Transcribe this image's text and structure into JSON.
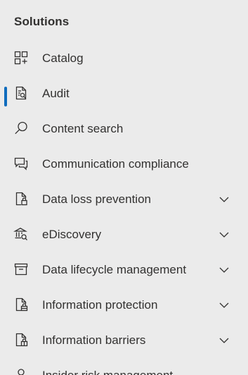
{
  "sidebar": {
    "section_title": "Solutions",
    "items": [
      {
        "label": "Catalog",
        "icon": "catalog-icon",
        "selected": false,
        "expandable": false
      },
      {
        "label": "Audit",
        "icon": "audit-icon",
        "selected": true,
        "expandable": false
      },
      {
        "label": "Content search",
        "icon": "search-icon",
        "selected": false,
        "expandable": false
      },
      {
        "label": "Communication compliance",
        "icon": "chat-icon",
        "selected": false,
        "expandable": false
      },
      {
        "label": "Data loss prevention",
        "icon": "lock-document-icon",
        "selected": false,
        "expandable": true
      },
      {
        "label": "eDiscovery",
        "icon": "courthouse-icon",
        "selected": false,
        "expandable": true
      },
      {
        "label": "Data lifecycle management",
        "icon": "archive-icon",
        "selected": false,
        "expandable": true
      },
      {
        "label": "Information protection",
        "icon": "protected-document-icon",
        "selected": false,
        "expandable": true
      },
      {
        "label": "Information barriers",
        "icon": "barrier-document-icon",
        "selected": false,
        "expandable": true
      },
      {
        "label": "Insider risk management",
        "icon": "person-icon",
        "selected": false,
        "expandable": false
      }
    ],
    "colors": {
      "background": "#ebebeb",
      "accent": "#0f6cbd",
      "text": "#323130"
    }
  }
}
